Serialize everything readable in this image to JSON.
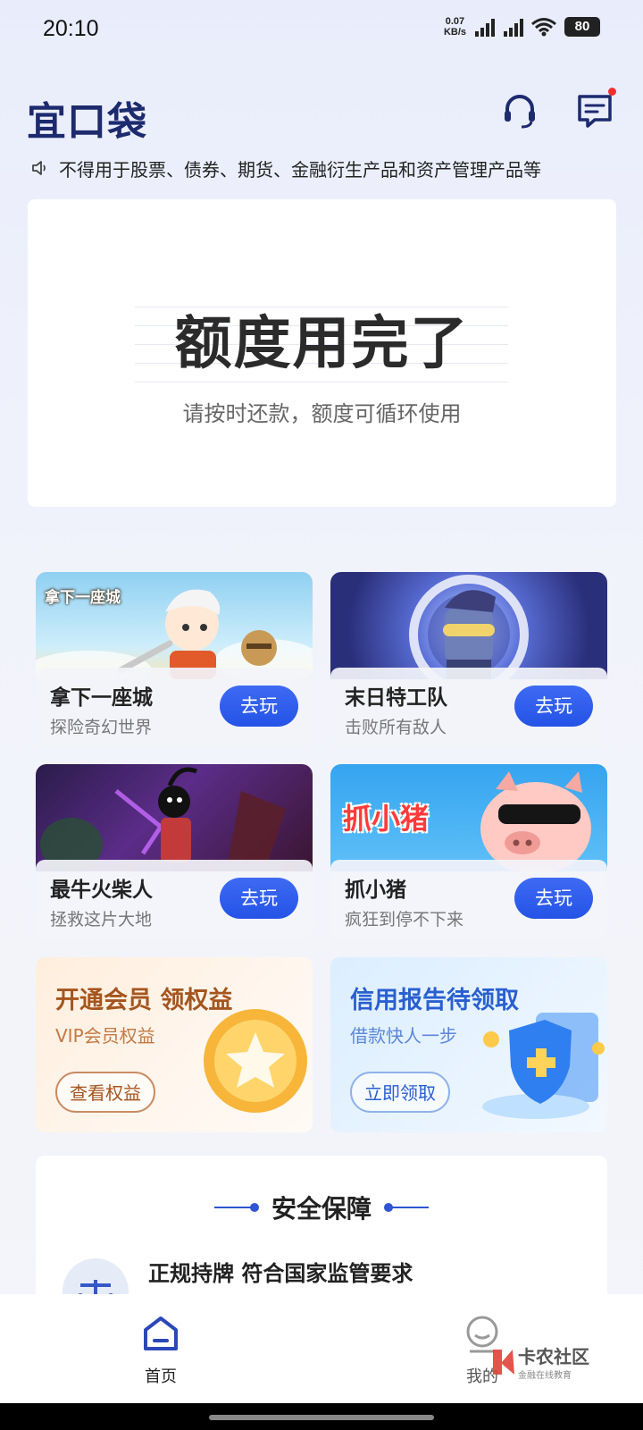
{
  "status_bar": {
    "time": "20:10",
    "net_speed_value": "0.07",
    "net_speed_unit": "KB/s",
    "signal_1_label": "5G",
    "signal_2_label": "5G",
    "battery": "80"
  },
  "header": {
    "logo": "宜口袋",
    "support_icon": "headset-icon",
    "message_icon": "message-icon"
  },
  "notice": {
    "icon": "speaker-icon",
    "text": "不得用于股票、债券、期货、金融衍生产品和资产管理产品等"
  },
  "quota": {
    "title": "额度用完了",
    "subtitle": "请按时还款，额度可循环使用"
  },
  "games": [
    {
      "art_caption": "拿下一座城",
      "title": "拿下一座城",
      "subtitle": "探险奇幻世界",
      "button": "去玩"
    },
    {
      "art_caption": "",
      "title": "末日特工队",
      "subtitle": "击败所有敌人",
      "button": "去玩"
    },
    {
      "art_caption": "",
      "title": "最牛火柴人",
      "subtitle": "拯救这片大地",
      "button": "去玩"
    },
    {
      "art_caption": "抓小猪",
      "title": "抓小猪",
      "subtitle": "疯狂到停不下来",
      "button": "去玩"
    }
  ],
  "promos": {
    "vip": {
      "title": "开通会员 领权益",
      "subtitle": "VIP会员权益",
      "button": "查看权益"
    },
    "credit": {
      "title": "信用报告待领取",
      "subtitle": "借款快人一步",
      "button": "立即领取"
    }
  },
  "security": {
    "title": "安全保障",
    "item": "正规持牌 符合国家监管要求"
  },
  "tabbar": {
    "home": "首页",
    "mine": "我的"
  },
  "watermark": {
    "main": "卡农社区",
    "sub": "金融在线教育"
  },
  "colors": {
    "accent": "#2453e6",
    "logo": "#1d2a6e",
    "vip_text": "#a5551f",
    "credit_text": "#2a5fd0"
  }
}
